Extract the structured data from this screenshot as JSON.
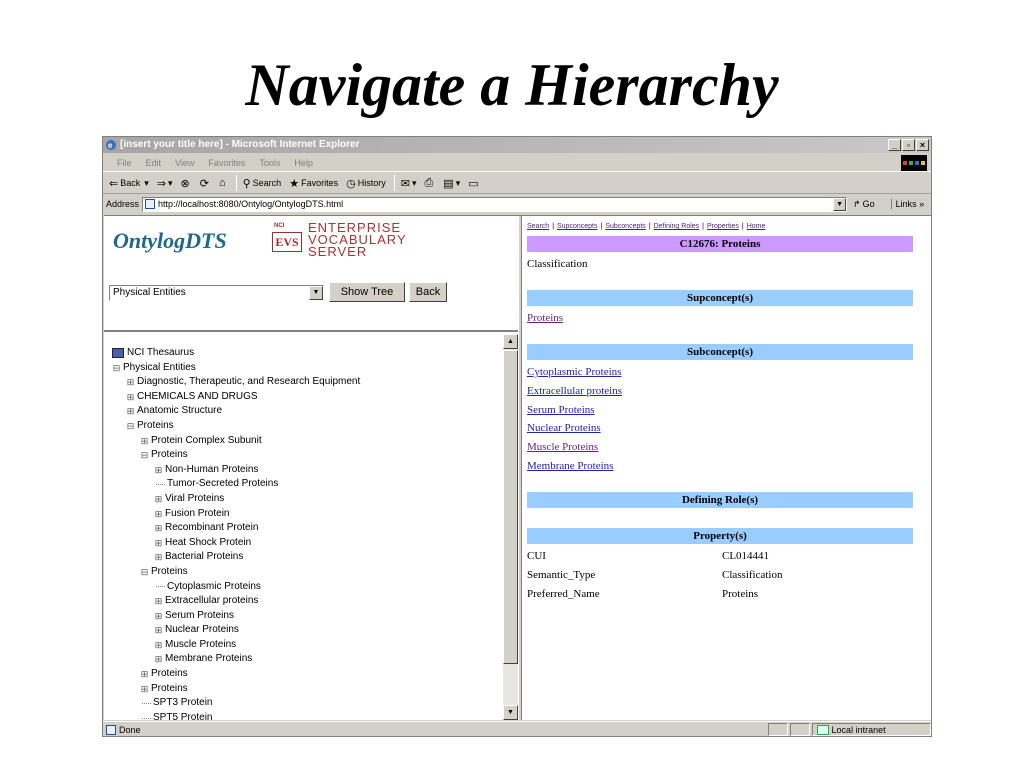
{
  "slide_title": "Navigate a Hierarchy",
  "browser": {
    "title": "[insert your title here] - Microsoft Internet Explorer",
    "menu": [
      "File",
      "Edit",
      "View",
      "Favorites",
      "Tools",
      "Help"
    ],
    "toolbar": {
      "back": "Back",
      "search": "Search",
      "favorites": "Favorites",
      "history": "History"
    },
    "address_label": "Address",
    "address_url": "http://localhost:8080/Ontylog/OntylogDTS.html",
    "go_label": "Go",
    "links_label": "Links »",
    "status_text": "Done",
    "zone_text": "Local intranet"
  },
  "header": {
    "logo_text": "OntylogDTS",
    "evs_box": "EVS",
    "nci_mini": "NATIONAL CANCER INSTITUTE",
    "evs_lines": [
      "ENTERPRISE",
      "VOCABULARY",
      "SERVER"
    ],
    "select_value": "Physical Entities",
    "show_tree_label": "Show Tree",
    "back_label": "Back"
  },
  "tree": {
    "rows": [
      {
        "label": "NCI Thesaurus",
        "type": "root"
      },
      {
        "label": "Physical Entities",
        "type": "minus"
      },
      {
        "label": "Diagnostic, Therapeutic, and Research Equipment",
        "type": "plus"
      },
      {
        "label": "CHEMICALS AND DRUGS",
        "type": "plus"
      },
      {
        "label": "Anatomic Structure",
        "type": "plus"
      },
      {
        "label": "Proteins",
        "type": "minus"
      },
      {
        "label": "Protein Complex Subunit",
        "type": "plus"
      },
      {
        "label": "Proteins",
        "type": "minus"
      },
      {
        "label": "Non-Human Proteins",
        "type": "plus"
      },
      {
        "label": "Tumor-Secreted Proteins",
        "type": "leaf"
      },
      {
        "label": "Viral Proteins",
        "type": "plus"
      },
      {
        "label": "Fusion Protein",
        "type": "plus"
      },
      {
        "label": "Recombinant Protein",
        "type": "plus"
      },
      {
        "label": "Heat Shock Protein",
        "type": "plus"
      },
      {
        "label": "Bacterial Proteins",
        "type": "plus"
      },
      {
        "label": "Proteins",
        "type": "minus"
      },
      {
        "label": "Cytoplasmic Proteins",
        "type": "leaf"
      },
      {
        "label": "Extracellular proteins",
        "type": "plus"
      },
      {
        "label": "Serum Proteins",
        "type": "plus"
      },
      {
        "label": "Nuclear Proteins",
        "type": "plus"
      },
      {
        "label": "Muscle Proteins",
        "type": "plus"
      },
      {
        "label": "Membrane Proteins",
        "type": "plus"
      },
      {
        "label": "Proteins",
        "type": "plus"
      },
      {
        "label": "Proteins",
        "type": "plus"
      },
      {
        "label": "SPT3 Protein",
        "type": "leaf"
      },
      {
        "label": "SPT5 Protein",
        "type": "leaf"
      }
    ]
  },
  "detail": {
    "links": [
      "Search",
      "Supconcepts",
      "Subconcepts",
      "Defining Roles",
      "Properties",
      "Home"
    ],
    "concept_title": "C12676: Proteins",
    "kind": "Classification",
    "supconcepts_header": "Supconcept(s)",
    "supconcepts": [
      "Proteins"
    ],
    "subconcepts_header": "Subconcept(s)",
    "subconcepts": [
      "Cytoplasmic Proteins",
      "Extracellular proteins",
      "Serum Proteins",
      "Nuclear Proteins",
      "Muscle Proteins",
      "Membrane Proteins"
    ],
    "roles_header": "Defining Role(s)",
    "properties_header": "Property(s)",
    "properties": [
      {
        "name": "CUI",
        "value": "CL014441"
      },
      {
        "name": "Semantic_Type",
        "value": "Classification"
      },
      {
        "name": "Preferred_Name",
        "value": "Proteins"
      }
    ]
  }
}
